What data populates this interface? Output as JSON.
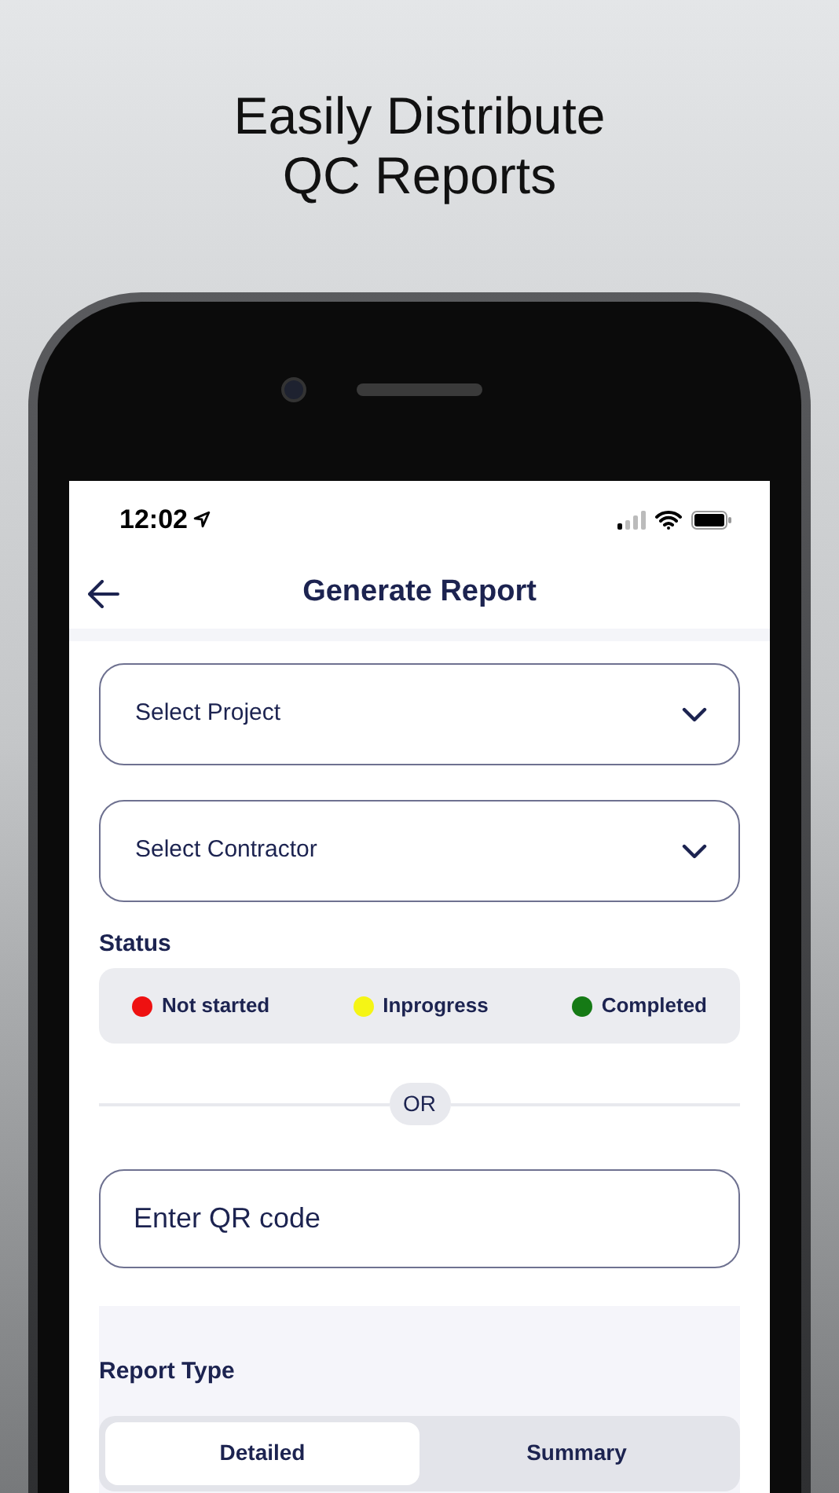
{
  "headline": [
    "Easily Distribute",
    "QC Reports"
  ],
  "status_bar": {
    "time": "12:02"
  },
  "header": {
    "title": "Generate Report"
  },
  "dropdowns": [
    {
      "placeholder": "Select Project"
    },
    {
      "placeholder": "Select Contractor"
    }
  ],
  "status": {
    "label": "Status",
    "items": [
      {
        "label": "Not started",
        "color": "#ee1111"
      },
      {
        "label": "Inprogress",
        "color": "#f5f515"
      },
      {
        "label": "Completed",
        "color": "#157a15"
      }
    ]
  },
  "separator": "OR",
  "qr_field": {
    "placeholder": "Enter QR code"
  },
  "report_type": {
    "label": "Report Type",
    "options": [
      {
        "label": "Detailed",
        "selected": true
      },
      {
        "label": "Summary",
        "selected": false
      }
    ]
  }
}
